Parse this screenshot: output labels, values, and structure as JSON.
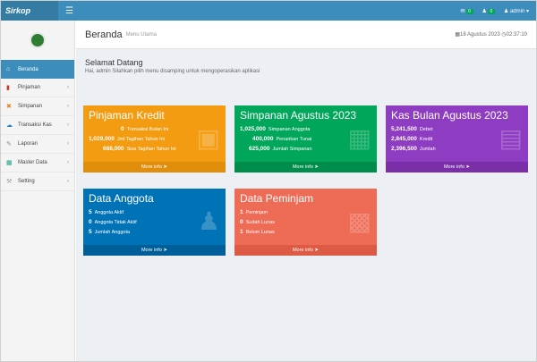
{
  "app": {
    "logo_text": "Sirkop"
  },
  "header": {
    "menu_icon": "hamburger-icon",
    "mail_badge": "0",
    "user_badge": "0",
    "user_label": "admin"
  },
  "sidebar": {
    "items": [
      {
        "label": "Beranda",
        "icon": "home-icon",
        "active": true
      },
      {
        "label": "Pinjaman",
        "icon": "chart-icon",
        "active": false
      },
      {
        "label": "Simpanan",
        "icon": "money-icon",
        "active": false
      },
      {
        "label": "Transaksi Kas",
        "icon": "cash-icon",
        "active": false
      },
      {
        "label": "Laporan",
        "icon": "report-icon",
        "active": false
      },
      {
        "label": "Master Data",
        "icon": "database-icon",
        "active": false
      },
      {
        "label": "Setting",
        "icon": "wrench-icon",
        "active": false
      }
    ]
  },
  "page": {
    "title": "Beranda",
    "subtitle": "Menu Utama",
    "date": "18 Agustus 2023",
    "time": "02:37:10",
    "welcome_title": "Selamat Datang",
    "welcome_text": "Hai, admin Silahkan pilih menu disamping untuk mengoperasikan aplikasi"
  },
  "boxes": {
    "pinjaman": {
      "title": "Pinjaman Kredit",
      "lines": [
        {
          "value": "0",
          "label": "Transaksi Bulan Ini"
        },
        {
          "value": "1,029,000",
          "label": "Jml Tagihan Tahun Ini"
        },
        {
          "value": "688,000",
          "label": "Sisa Tagihan Tahun Ini"
        }
      ],
      "more": "More info"
    },
    "simpanan": {
      "title": "Simpanan Agustus 2023",
      "lines": [
        {
          "value": "1,025,000",
          "label": "Simpanan Anggota"
        },
        {
          "value": "400,000",
          "label": "Penarikan Tunai"
        },
        {
          "value": "625,000",
          "label": "Jumlah Simpanan"
        }
      ],
      "more": "More info"
    },
    "kas": {
      "title": "Kas Bulan Agustus 2023",
      "lines": [
        {
          "value": "5,241,500",
          "label": "Debet"
        },
        {
          "value": "2,845,000",
          "label": "Kredit"
        },
        {
          "value": "2,396,500",
          "label": "Jumlah"
        }
      ],
      "more": "More info"
    },
    "anggota": {
      "title": "Data Anggota",
      "lines": [
        {
          "value": "5",
          "label": "Anggota Aktif"
        },
        {
          "value": "0",
          "label": "Anggota Tidak Aktif"
        },
        {
          "value": "5",
          "label": "Jumlah Anggota"
        }
      ],
      "more": "More info"
    },
    "peminjam": {
      "title": "Data Peminjam",
      "lines": [
        {
          "value": "1",
          "label": "Peminjam"
        },
        {
          "value": "0",
          "label": "Sudah Lunas"
        },
        {
          "value": "1",
          "label": "Belum Lunas"
        }
      ],
      "more": "More info"
    }
  }
}
